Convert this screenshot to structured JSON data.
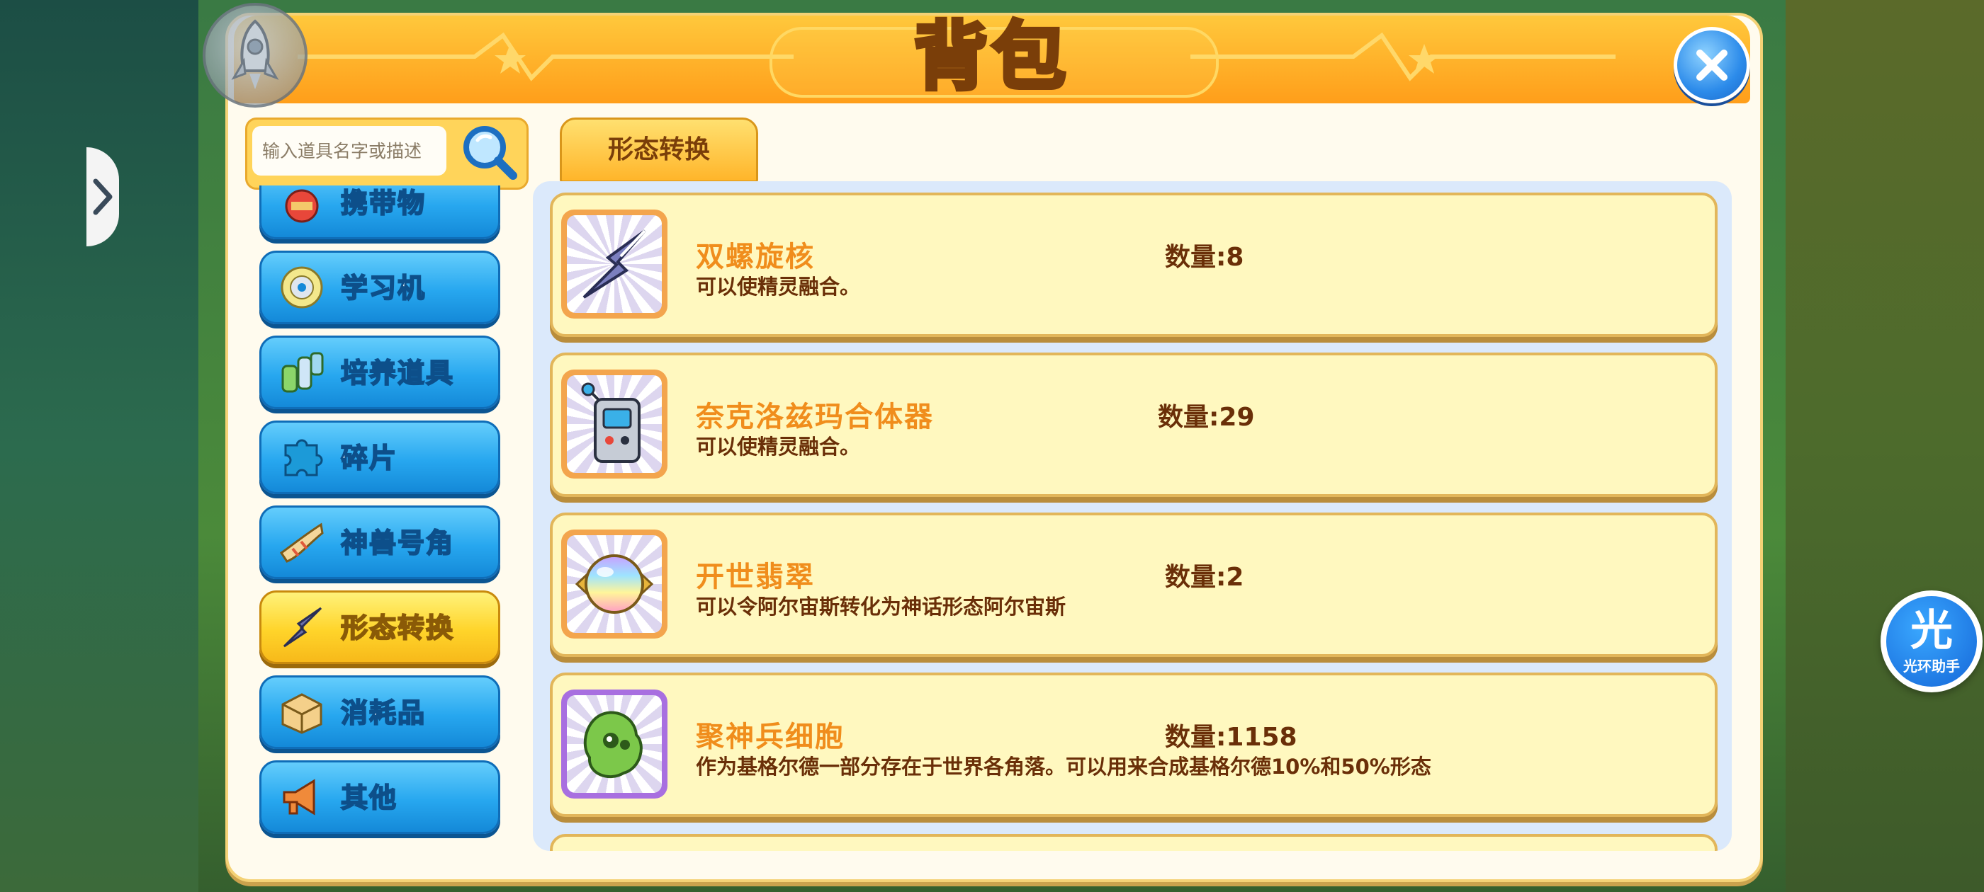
{
  "window": {
    "title": "背包"
  },
  "search": {
    "placeholder": "输入道具名字或描述"
  },
  "categories": [
    {
      "label": "携带物",
      "icon": "carry-item-icon",
      "active": false
    },
    {
      "label": "学习机",
      "icon": "disc-icon",
      "active": false
    },
    {
      "label": "培养道具",
      "icon": "potion-bottles-icon",
      "active": false
    },
    {
      "label": "碎片",
      "icon": "puzzle-piece-icon",
      "active": false
    },
    {
      "label": "神兽号角",
      "icon": "horn-icon",
      "active": false
    },
    {
      "label": "形态转换",
      "icon": "arrowhead-icon",
      "active": true
    },
    {
      "label": "消耗品",
      "icon": "box-icon",
      "active": false
    },
    {
      "label": "其他",
      "icon": "megaphone-icon",
      "active": false
    }
  ],
  "tab": {
    "label": "形态转换"
  },
  "items": [
    {
      "name": "双螺旋核",
      "quantity": "数量:8",
      "description": "可以使精灵融合。",
      "icon": "double-helix-core-icon"
    },
    {
      "name": "奈克洛兹玛合体器",
      "quantity": "数量:29",
      "description": "可以使精灵融合。",
      "icon": "fuser-device-icon"
    },
    {
      "name": "开世翡翠",
      "quantity": "数量:2",
      "description": "可以令阿尔宙斯转化为神话形态阿尔宙斯",
      "icon": "jade-orb-icon"
    },
    {
      "name": "聚神兵细胞",
      "quantity": "数量:1158",
      "description": "作为基格尔德一部分存在于世界各角落。可以用来合成基格尔德10%和50%形态",
      "icon": "zygarde-cell-icon"
    }
  ],
  "helper": {
    "glyph": "光",
    "label": "光环助手"
  },
  "colors": {
    "header": "#ff9e1a",
    "item_name": "#f08d1c",
    "category_blue": "#27a7ef",
    "category_active": "#ffd42a"
  }
}
